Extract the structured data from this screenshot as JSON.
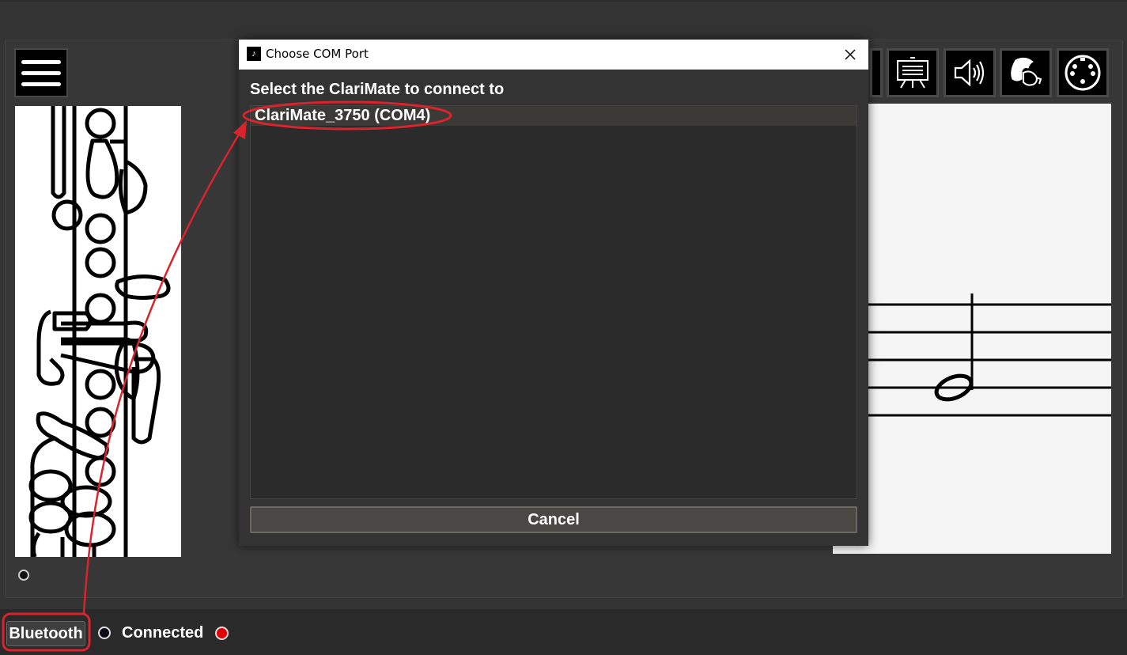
{
  "toolbar": {
    "menu_icon": "hamburger-menu-icon",
    "buttons": [
      {
        "icon": "music-stand-icon"
      },
      {
        "icon": "speaker-icon"
      },
      {
        "icon": "player-face-icon"
      },
      {
        "icon": "midi-connector-icon"
      }
    ]
  },
  "dialog": {
    "title": "Choose COM Port",
    "heading": "Select the ClariMate to connect to",
    "items": [
      "ClariMate_3750 (COM4)"
    ],
    "cancel_label": "Cancel"
  },
  "status_bar": {
    "bluetooth_label": "Bluetooth",
    "connected_label": "Connected",
    "connected_color": "#e00000"
  },
  "annotation": {
    "color": "#d9232d"
  }
}
